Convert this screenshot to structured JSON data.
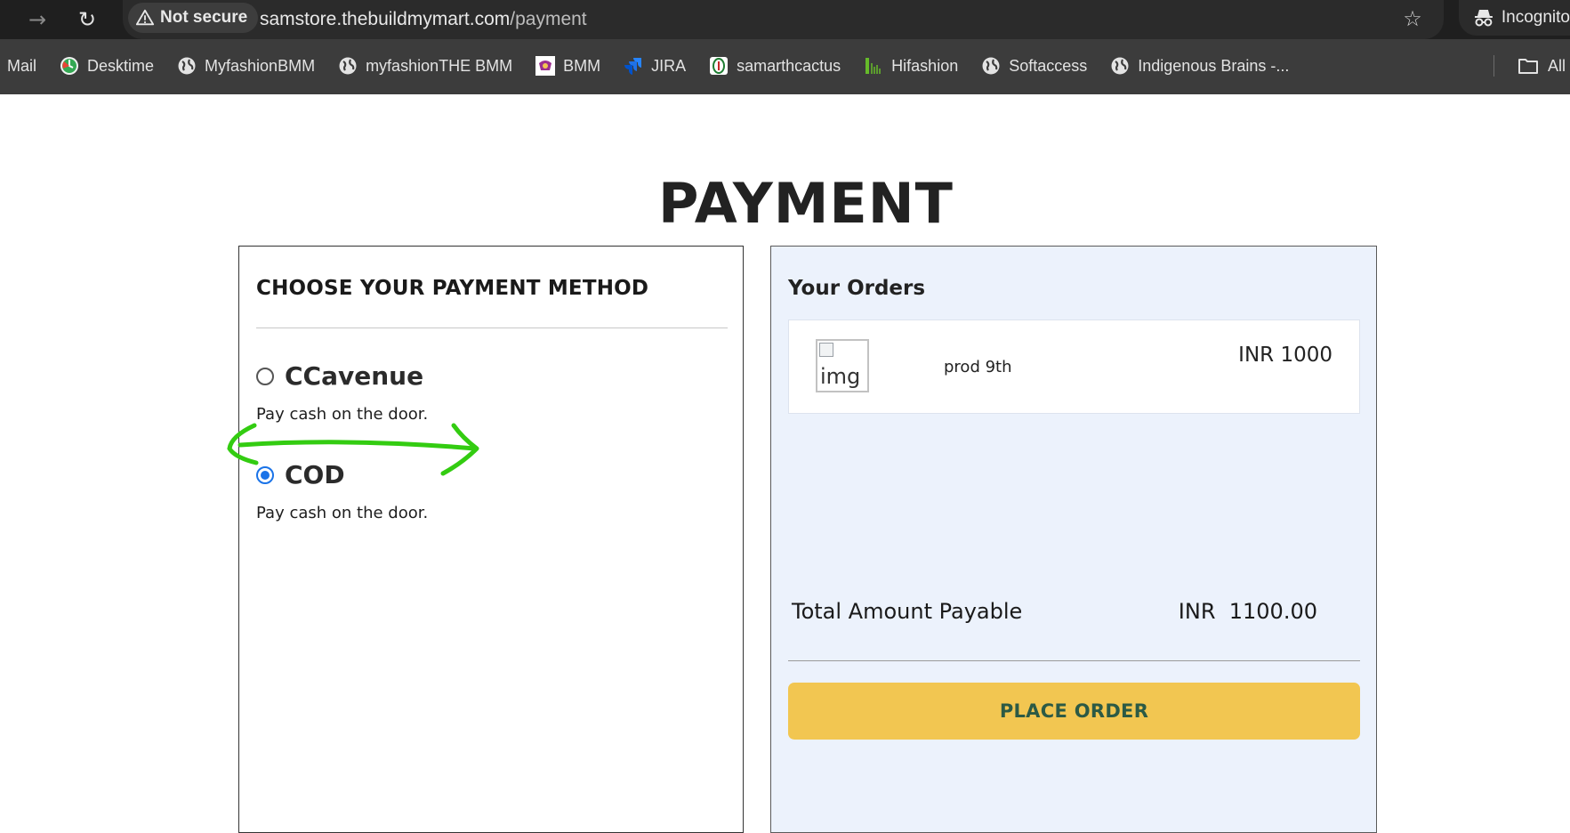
{
  "browser": {
    "security_label": "Not secure",
    "url_host": "samstore.thebuildmymart.com",
    "url_path": "/payment",
    "incognito_label": "Incognito",
    "icons": {
      "back": "back-arrow-icon",
      "reload": "reload-icon",
      "star": "bookmark-star-icon"
    }
  },
  "bookmarks": {
    "items": [
      {
        "label": "Mail",
        "icon": ""
      },
      {
        "label": "Desktime",
        "icon": "desktime-icon"
      },
      {
        "label": "MyfashionBMM",
        "icon": "globe-icon"
      },
      {
        "label": "myfashionTHE BMM",
        "icon": "globe-icon"
      },
      {
        "label": "BMM",
        "icon": "bmm-logo-icon"
      },
      {
        "label": "JIRA",
        "icon": "jira-icon"
      },
      {
        "label": "samarthcactus",
        "icon": "cactus-icon"
      },
      {
        "label": "Hifashion",
        "icon": "hifashion-icon"
      },
      {
        "label": "Softaccess",
        "icon": "globe-icon"
      },
      {
        "label": "Indigenous Brains -...",
        "icon": "globe-icon"
      }
    ],
    "all_label": "All"
  },
  "page": {
    "title": "PAYMENT",
    "payment": {
      "heading": "CHOOSE YOUR PAYMENT METHOD",
      "methods": [
        {
          "label": "CCavenue",
          "description": "Pay cash on the door.",
          "selected": false
        },
        {
          "label": "COD",
          "description": "Pay cash on the door.",
          "selected": true
        }
      ]
    },
    "orders": {
      "heading": "Your Orders",
      "items": [
        {
          "image_alt": "img",
          "name": "prod 9th",
          "price": "INR 1000"
        }
      ],
      "total_label": "Total Amount Payable",
      "total_value": "INR  1100.00",
      "place_order_label": "PLACE ORDER"
    }
  },
  "colors": {
    "accent_button": "#f2c651",
    "button_text": "#2c5a45",
    "orders_bg": "#ecf2fc",
    "annotation_arrow": "#33cc11",
    "radio_selected": "#1a73e8"
  }
}
